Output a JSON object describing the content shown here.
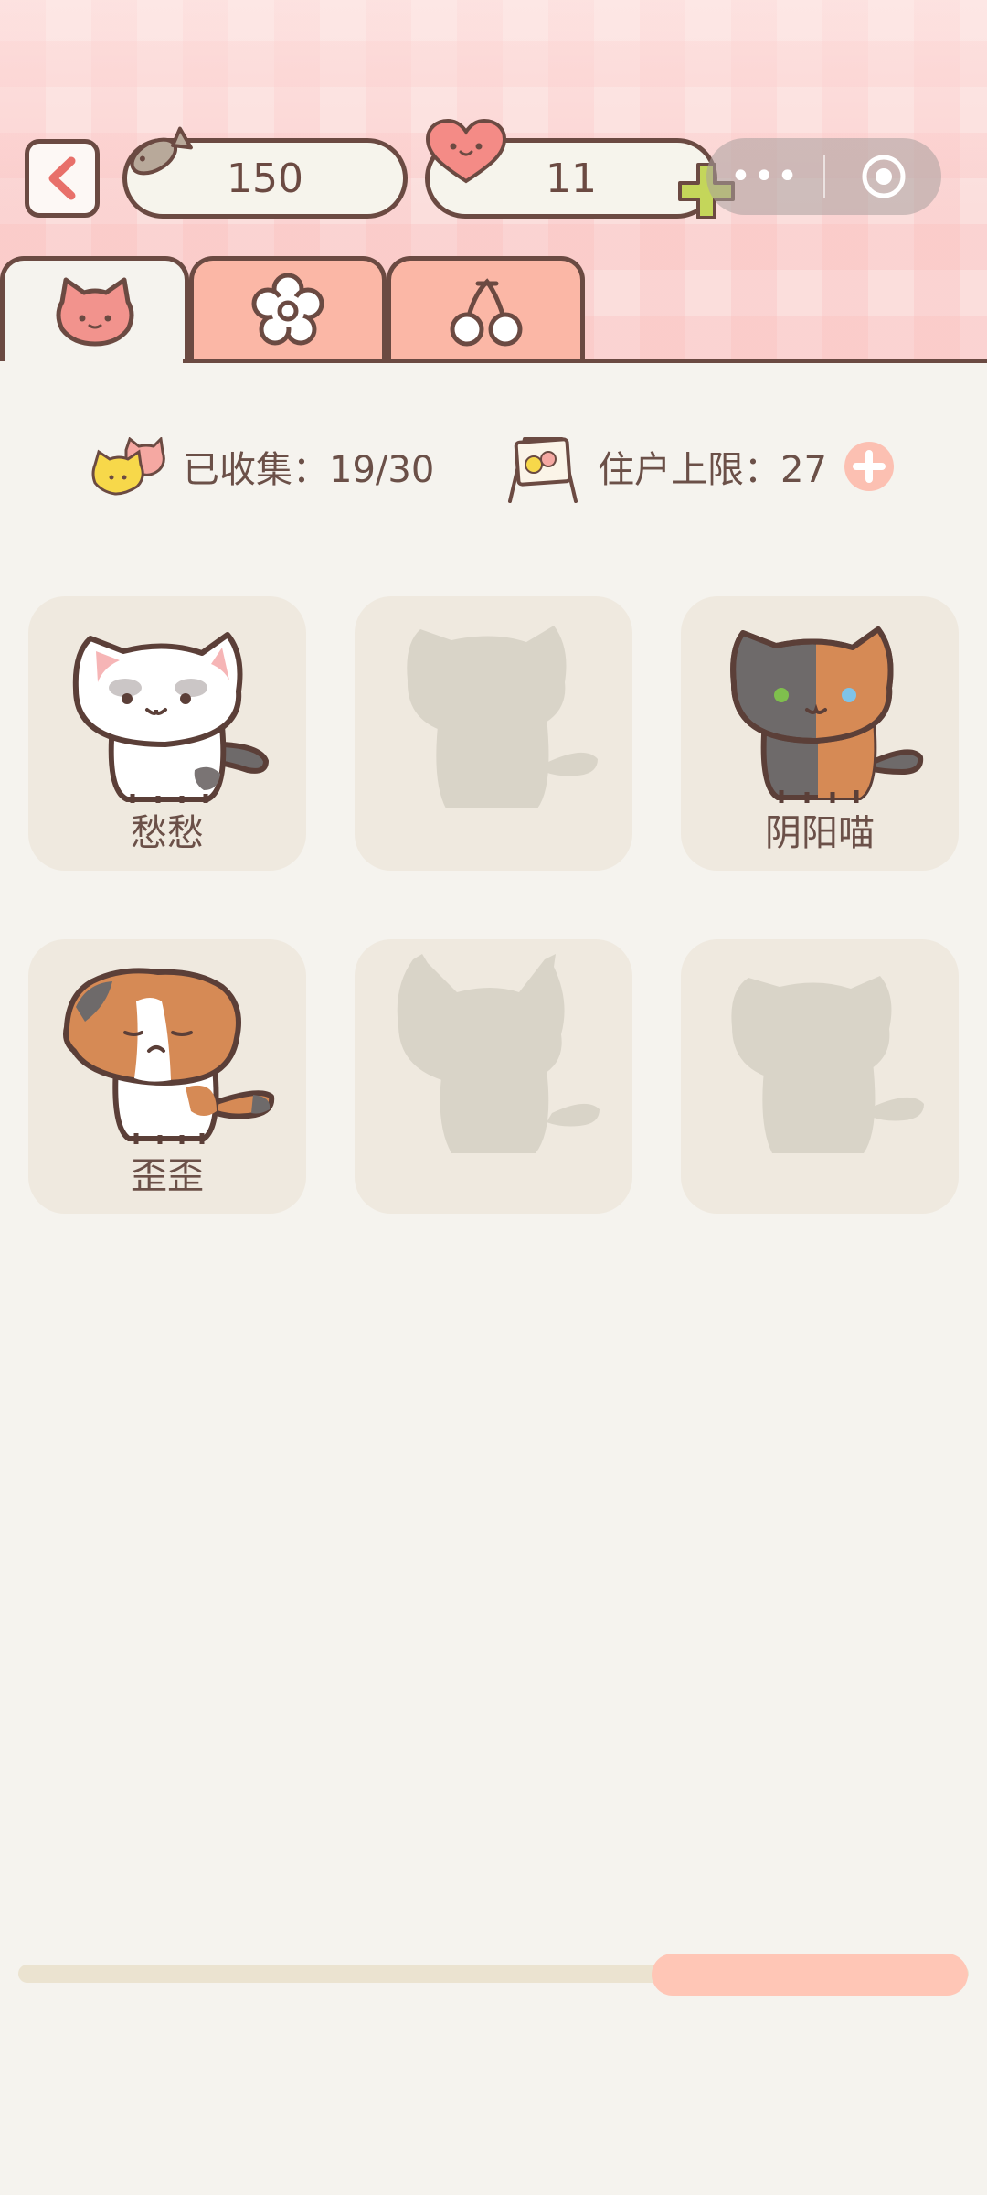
{
  "header": {
    "fish_count": "150",
    "heart_count": "11",
    "capsule_more": "•••"
  },
  "tabs": [
    {
      "name": "cats",
      "icon": "cat-face-icon",
      "active": true
    },
    {
      "name": "flowers",
      "icon": "flower-icon",
      "active": false
    },
    {
      "name": "cherries",
      "icon": "cherry-icon",
      "active": false
    }
  ],
  "stats": {
    "collected_label": "已收集：19/30",
    "limit_label": "住户上限：27"
  },
  "cats": [
    {
      "name": "愁愁",
      "unlocked": true
    },
    {
      "name": "",
      "unlocked": false
    },
    {
      "name": "阴阳喵",
      "unlocked": true
    },
    {
      "name": "歪歪",
      "unlocked": true
    },
    {
      "name": "",
      "unlocked": false
    },
    {
      "name": "",
      "unlocked": false
    }
  ],
  "scroll": {
    "position": 0.67
  },
  "colors": {
    "outline": "#6b4a42",
    "tab_inactive": "#fbb7a6",
    "card_bg": "#efe9df",
    "silhouette": "#d9d4c8",
    "accent_pink": "#ffc6b6",
    "plus_green": "#c4d65a"
  }
}
